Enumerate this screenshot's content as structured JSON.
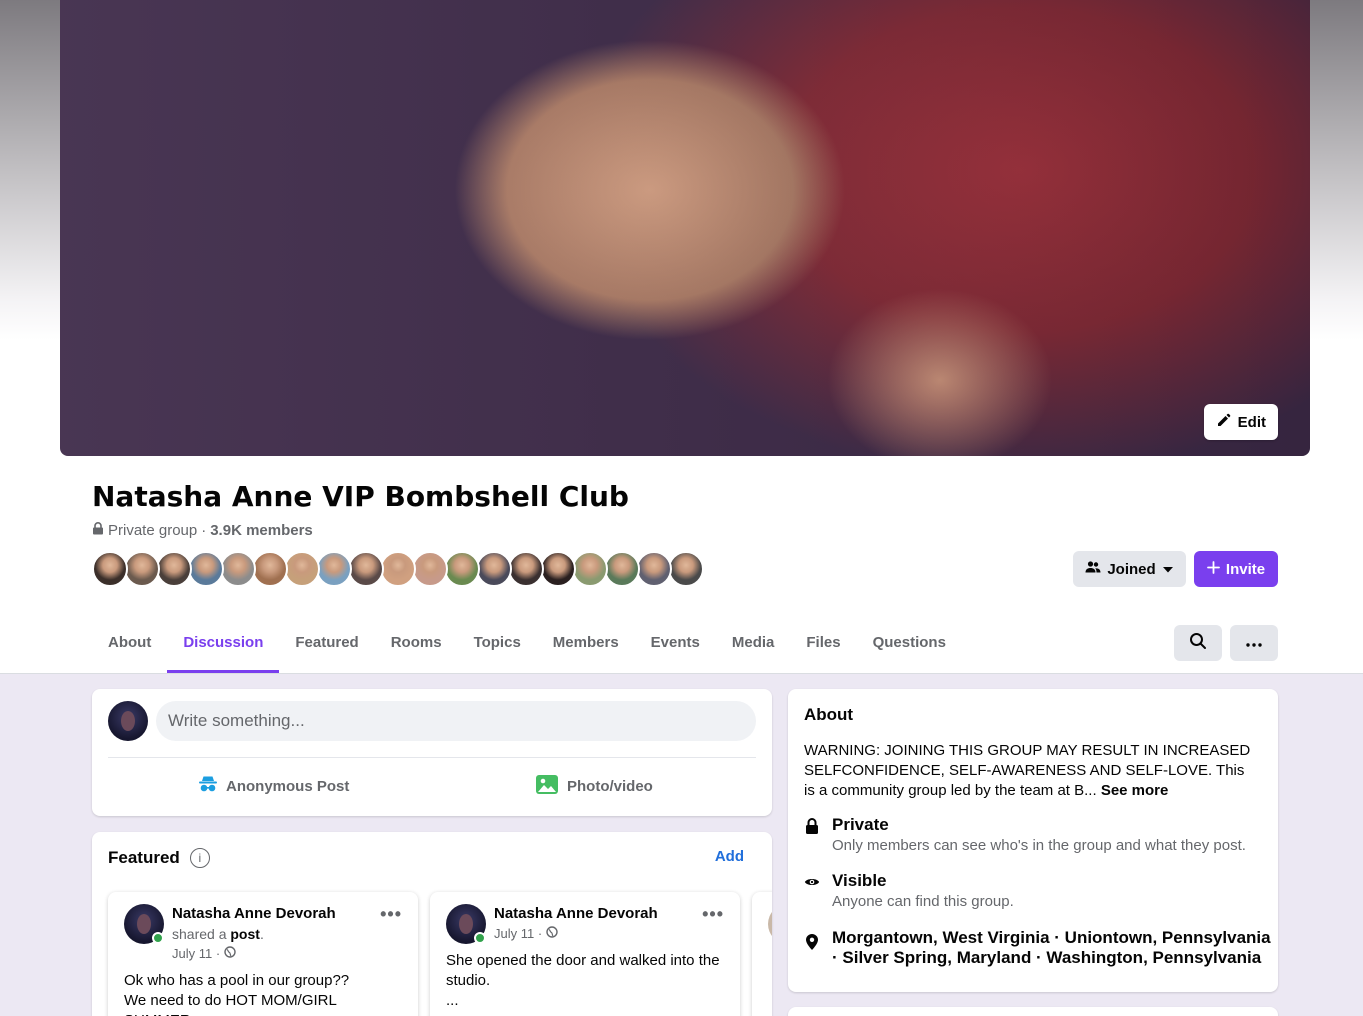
{
  "cover": {
    "edit_label": "Edit"
  },
  "group": {
    "name": "Natasha Anne VIP Bombshell Club",
    "privacy": "Private group",
    "separator": "·",
    "members": "3.9K members",
    "joined_label": "Joined",
    "invite_label": "Invite",
    "member_avatar_colors": [
      "#3b2f2a",
      "#6b5a4e",
      "#4a3f3a",
      "#5a7a9a",
      "#8c8c8c",
      "#a07050",
      "#c6a07a",
      "#7aa0c0",
      "#5a4a48",
      "#d0a080",
      "#c79a8a",
      "#6a8a50",
      "#4a4a5a",
      "#3a3030",
      "#2a2020",
      "#8a9a70",
      "#5a7a5a",
      "#606070",
      "#4a4a4a"
    ]
  },
  "tabs": [
    "About",
    "Discussion",
    "Featured",
    "Rooms",
    "Topics",
    "Members",
    "Events",
    "Media",
    "Files",
    "Questions"
  ],
  "active_tab": "Discussion",
  "composer": {
    "placeholder": "Write something...",
    "anonymous_label": "Anonymous Post",
    "photo_label": "Photo/video"
  },
  "featured": {
    "title": "Featured",
    "info_symbol": "i",
    "add_label": "Add",
    "posts": [
      {
        "author": "Natasha Anne Devorah",
        "shared_prefix": "shared a",
        "shared_object": "post",
        "shared_suffix": ".",
        "date": "July 11 ·",
        "body_line1": "Ok who has a pool in our group??",
        "body_line2": "We need to do HOT MOM/GIRL SUMMER"
      },
      {
        "author": "Natasha Anne Devorah",
        "date": "July 11 ·",
        "body_line1": "She opened the door and walked into the studio.",
        "body_line2": "..."
      }
    ]
  },
  "about": {
    "title": "About",
    "description": "WARNING: JOINING THIS GROUP MAY RESULT IN INCREASED SELFCONFIDENCE, SELF-AWARENESS AND SELF-LOVE. This is a community group led by the team at B...",
    "see_more": "See more",
    "privacy_title": "Private",
    "privacy_desc": "Only members can see who's in the group and what they post.",
    "visibility_title": "Visible",
    "visibility_desc": "Anyone can find this group.",
    "locations": "Morgantown, West Virginia · Uniontown, Pennsylvania · Silver Spring, Maryland · Washington, Pennsylvania"
  },
  "colors": {
    "accent": "#7a3fee",
    "link": "#216fdb",
    "feed_bg": "#ece8f3"
  },
  "icons": [
    "pencil-icon",
    "lock-icon",
    "people-icon",
    "chevron-down-icon",
    "plus-icon",
    "search-icon",
    "more-icon",
    "incognito-icon",
    "photo-icon",
    "info-icon",
    "globe-icon",
    "eye-icon",
    "location-pin-icon"
  ]
}
